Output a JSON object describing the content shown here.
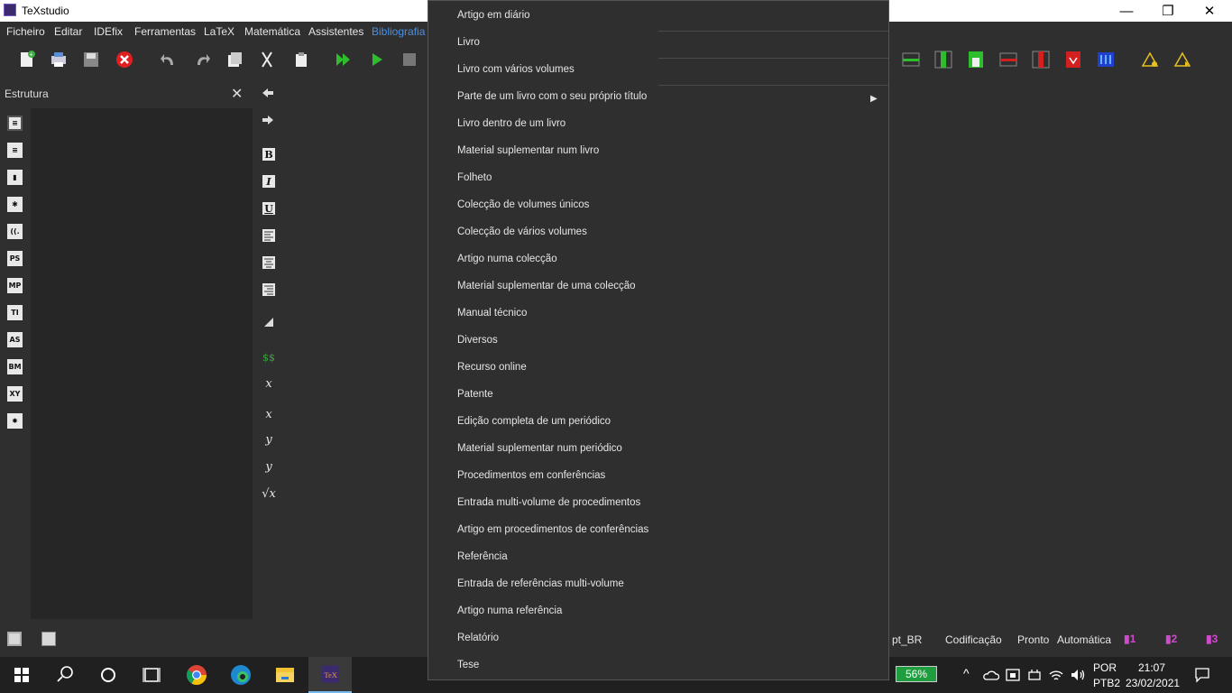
{
  "window": {
    "title": "TeXstudio",
    "controls": {
      "minimize": "—",
      "restore": "❐",
      "close": "✕"
    }
  },
  "menubar": {
    "items": [
      "Ficheiro",
      "Editar",
      "IDEfix",
      "Ferramentas",
      "LaTeX",
      "Matemática",
      "Assistentes",
      "Bibliografia"
    ],
    "active": "Bibliografia"
  },
  "structure_panel": {
    "title": "Estrutura",
    "close": "✕"
  },
  "side_icons": [
    "≡",
    "≡",
    "▮",
    "✱",
    "((.",
    "PS",
    "MP",
    "TI",
    "AS",
    "BM",
    "XY",
    "✸"
  ],
  "vertical_toolbar": {
    "bold": "B",
    "italic": "I",
    "underline": "U",
    "dollars": "$$",
    "subscript": "x",
    "superscript": "x",
    "frac": "y",
    "dfrac": "y",
    "sqrt": "√x"
  },
  "dropdown_menu": {
    "items": [
      "Artigo em diário",
      "Livro",
      "Livro com vários volumes",
      "Parte de um livro com o seu próprio título",
      "Livro dentro de um livro",
      "Material suplementar num livro",
      "Folheto",
      "Colecção de volumes únicos",
      "Colecção de vários volumes",
      "Artigo numa colecção",
      "Material suplementar de uma colecção",
      "Manual técnico",
      "Diversos",
      "Recurso online",
      "Patente",
      "Edição completa de um periódico",
      "Material suplementar num periódico",
      "Procedimentos em conferências",
      "Entrada multi-volume de procedimentos",
      "Artigo em procedimentos de conferências",
      "Referência",
      "Entrada de referências multi-volume",
      "Artigo numa referência",
      "Relatório",
      "Tese"
    ],
    "submenu_arrow": "▶"
  },
  "statusbar": {
    "language": "pt_BR",
    "encoding": "Codificação",
    "status": "Pronto",
    "mode": "Automática",
    "bookmarks": [
      "1",
      "2",
      "3"
    ]
  },
  "taskbar": {
    "battery": "56%",
    "keyboard_lang": "POR",
    "keyboard_layout": "PTB2",
    "time": "21:07",
    "date": "23/02/2021",
    "tray_chevron": "^"
  },
  "colors": {
    "accent": "#4a90e2",
    "background": "#2f2f2f",
    "taskbar": "#202020",
    "battery": "#1e9e3e",
    "bookmark": "#d04ad0"
  }
}
